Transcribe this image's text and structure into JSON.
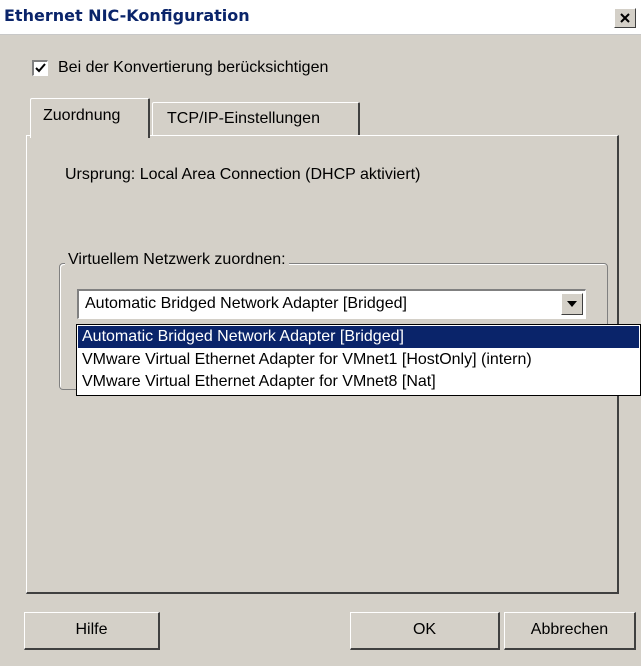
{
  "window": {
    "title": "Ethernet NIC-Konfiguration",
    "close_label": "X"
  },
  "checkbox": {
    "label": "Bei der Konvertierung berücksichtigen",
    "checked": true
  },
  "tabs": [
    {
      "label": "Zuordnung",
      "active": true
    },
    {
      "label": "TCP/IP-Einstellungen",
      "active": false
    }
  ],
  "mapping": {
    "source_text": "Ursprung:  Local Area Connection (DHCP aktiviert)",
    "group_label": "Virtuellem Netzwerk zuordnen:",
    "selected_value": "Automatic Bridged Network Adapter [Bridged]",
    "options": [
      "Automatic Bridged Network Adapter [Bridged]",
      "VMware Virtual Ethernet Adapter for VMnet1 [HostOnly] (intern)",
      "VMware Virtual Ethernet Adapter for VMnet8 [Nat]"
    ]
  },
  "buttons": {
    "help": "Hilfe",
    "ok": "OK",
    "cancel": "Abbrechen"
  },
  "colors": {
    "selection": "#0a246a",
    "face": "#d4d0c8"
  }
}
